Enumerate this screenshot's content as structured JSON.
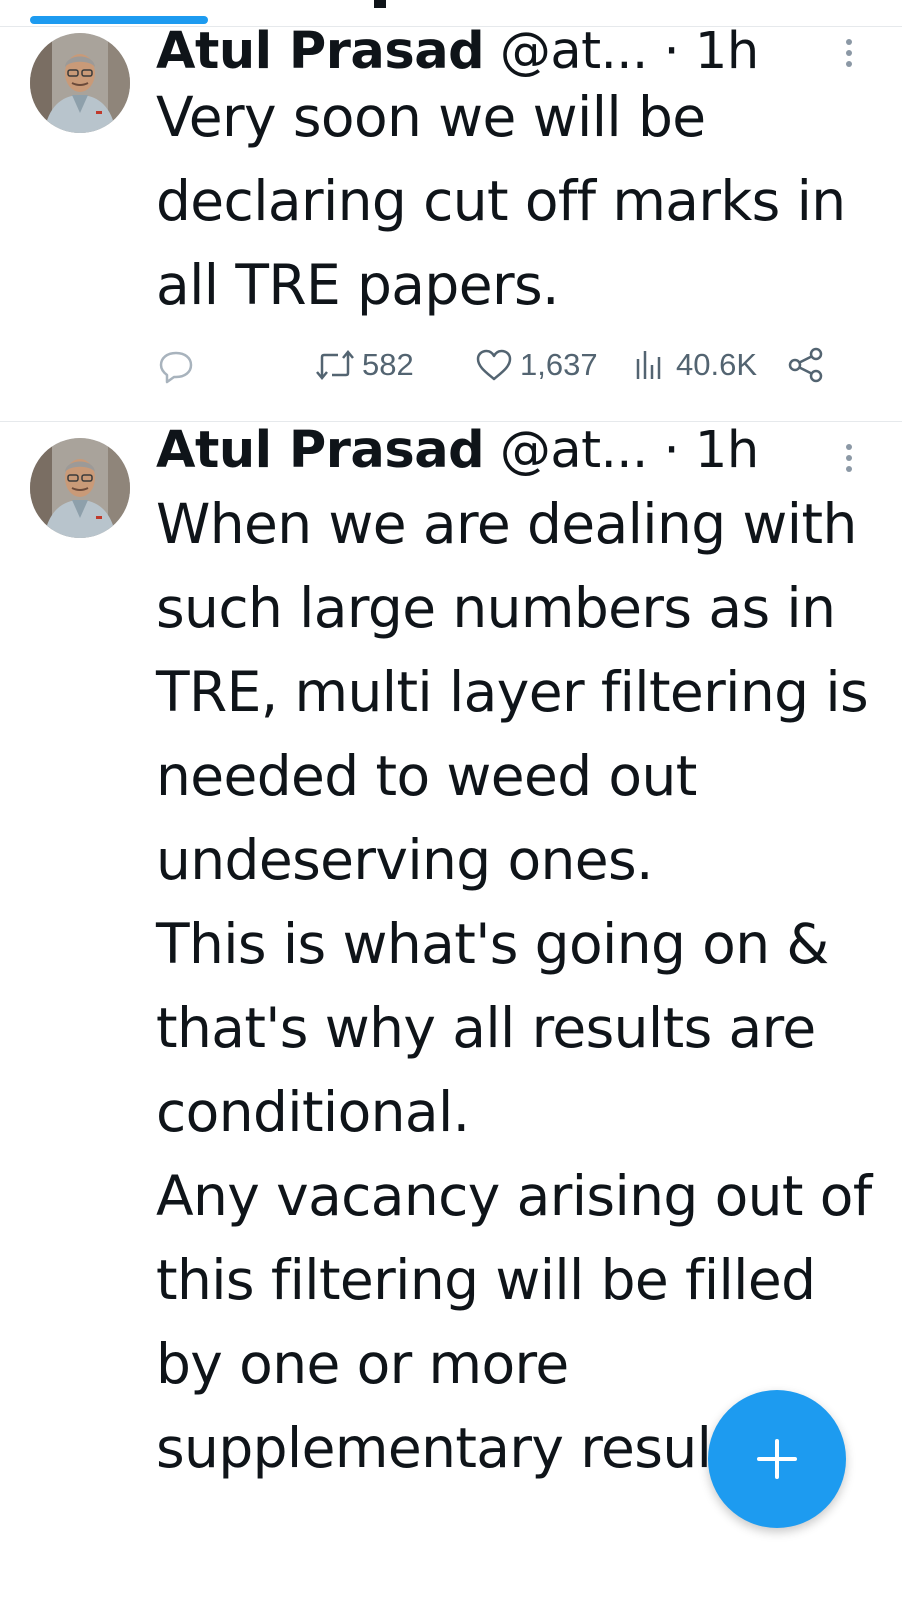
{
  "feed": {
    "active_tab_color": "#1d9bf0",
    "compose_icon": "plus-icon",
    "tweets": [
      {
        "author_name": "Atul Prasad",
        "handle": "@at...",
        "time": "· 1h",
        "paragraphs": [
          "Very soon we will be declaring cut off marks in all TRE papers."
        ],
        "reply_icon": "reply-icon",
        "retweets": "582",
        "likes": "1,637",
        "views": "40.6K",
        "share_icon": "share-icon"
      },
      {
        "author_name": "Atul Prasad",
        "handle": "@at...",
        "time": "· 1h",
        "paragraphs": [
          "When we are dealing with such large numbers as in TRE, multi layer filtering is needed to weed out undeserving ones.",
          "This is what's going on & that's why all results are conditional.",
          "Any vacancy arising out of this filtering will be filled by one or more supplementary results."
        ]
      }
    ]
  }
}
